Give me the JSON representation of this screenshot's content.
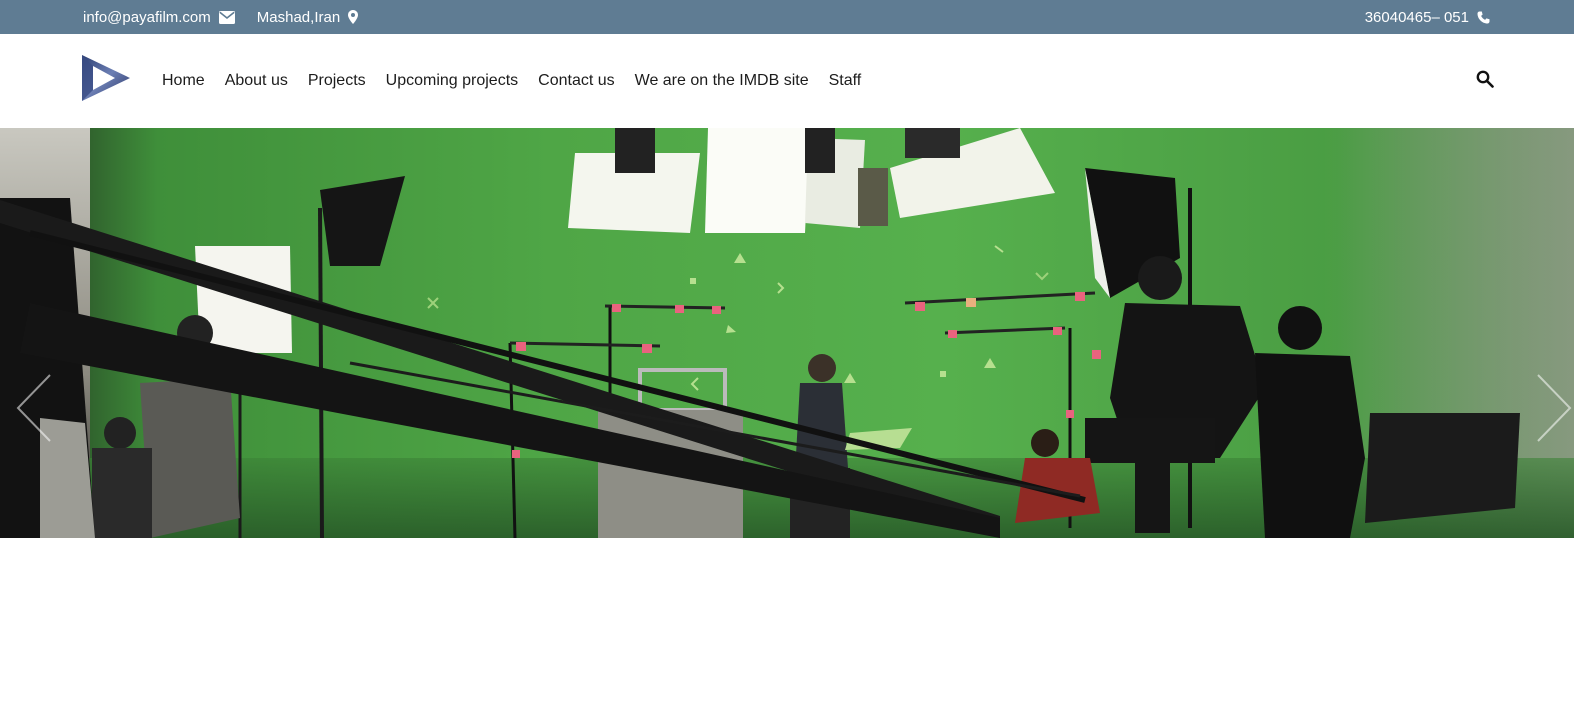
{
  "topbar": {
    "email": "info@payafilm.com",
    "email_icon": "envelope-icon",
    "location": "Mashad,Iran",
    "location_icon": "map-marker-icon",
    "phone": "36040465– 051",
    "phone_icon": "phone-icon",
    "background_color": "#5f7c93"
  },
  "header": {
    "logo_icon": "play-triangle-logo",
    "nav": [
      {
        "label": "Home"
      },
      {
        "label": "About us"
      },
      {
        "label": "Projects"
      },
      {
        "label": "Upcoming projects"
      },
      {
        "label": "Contact us"
      },
      {
        "label": "We are on the IMDB site"
      },
      {
        "label": "Staff"
      }
    ],
    "search_icon": "search-icon"
  },
  "hero": {
    "image_description_icon": "film-studio-green-screen-photo",
    "prev_icon": "chevron-left-icon",
    "next_icon": "chevron-right-icon"
  }
}
